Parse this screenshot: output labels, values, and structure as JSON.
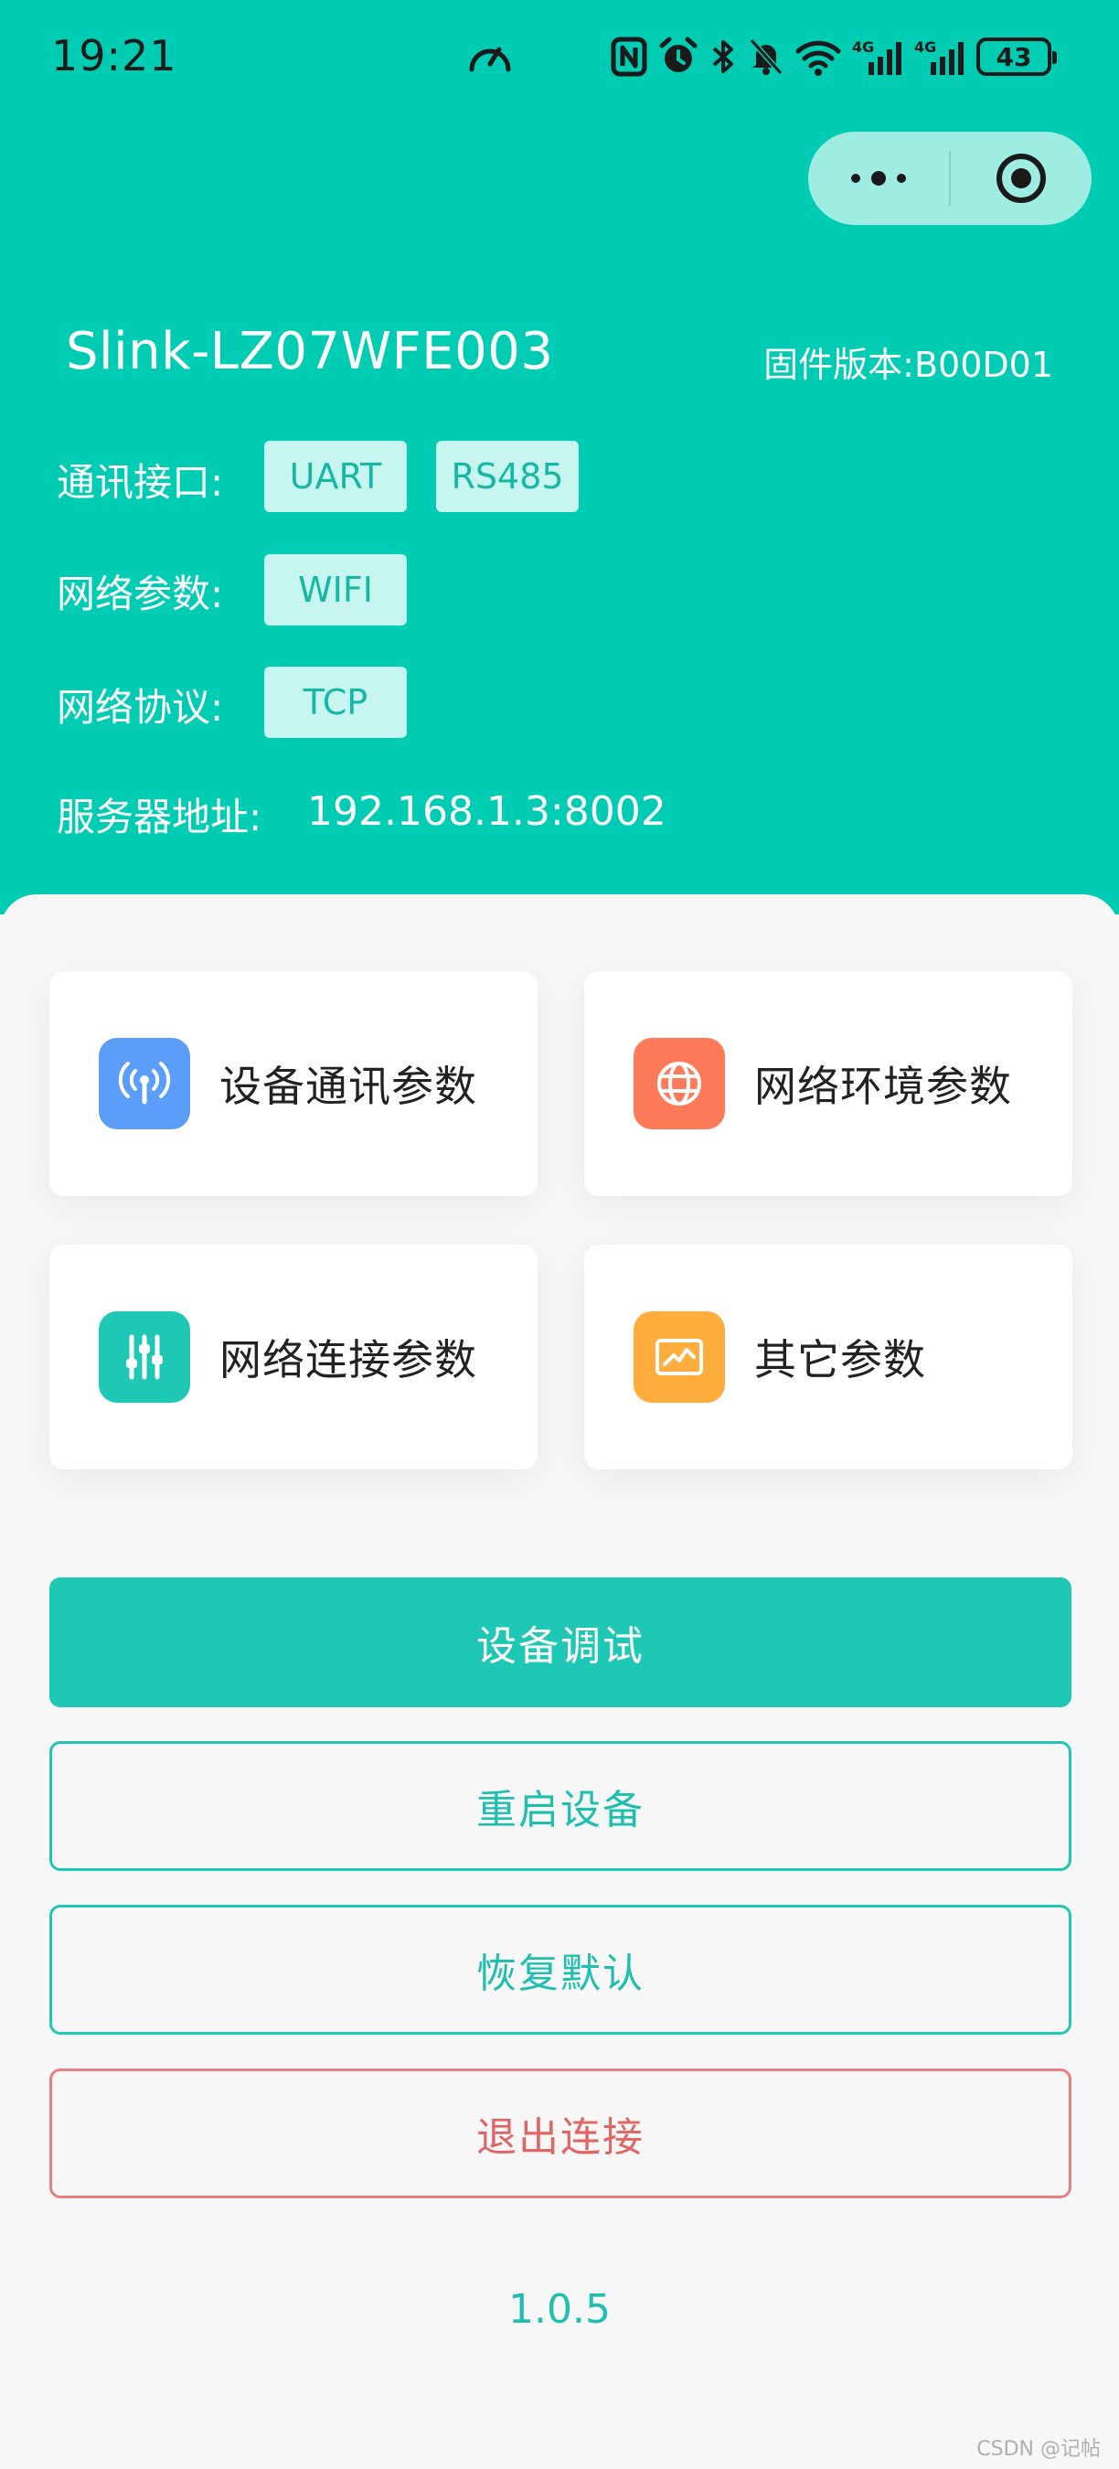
{
  "status_bar": {
    "time": "19:21",
    "battery": "43",
    "icons": [
      "speed-gauge-icon",
      "nfc-icon",
      "alarm-icon",
      "bluetooth-icon",
      "mute-icon",
      "wifi-icon",
      "signal-4g-icon",
      "signal-4g-icon"
    ]
  },
  "capsule": {
    "more_icon": "more-dots-icon",
    "close_icon": "target-close-icon"
  },
  "device": {
    "name": "Slink-LZ07WFE003",
    "firmware": "固件版本:B00D01"
  },
  "info": {
    "interface_label": "通讯接口:",
    "interface_tags": [
      "UART",
      "RS485"
    ],
    "network_label": "网络参数:",
    "network_tags": [
      "WIFI"
    ],
    "protocol_label": "网络协议:",
    "protocol_tags": [
      "TCP"
    ],
    "server_label": "服务器地址:",
    "server_value": "192.168.1.3:8002"
  },
  "cards": [
    {
      "label": "设备通讯参数",
      "icon": "antenna-icon",
      "color": "#5B9DFB"
    },
    {
      "label": "网络环境参数",
      "icon": "globe-icon",
      "color": "#FF7A59"
    },
    {
      "label": "网络连接参数",
      "icon": "sliders-icon",
      "color": "#1FC8B4"
    },
    {
      "label": "其它参数",
      "icon": "chart-monitor-icon",
      "color": "#FFAE3D"
    }
  ],
  "actions": {
    "debug": "设备调试",
    "restart": "重启设备",
    "reset": "恢复默认",
    "disconnect": "退出连接"
  },
  "version": "1.0.5",
  "watermark": "CSDN @记帖",
  "colors": {
    "primary": "#00CCB3",
    "accent": "#1FC8B4",
    "danger": "#E06666",
    "tag_bg": "#C6F6EF"
  }
}
